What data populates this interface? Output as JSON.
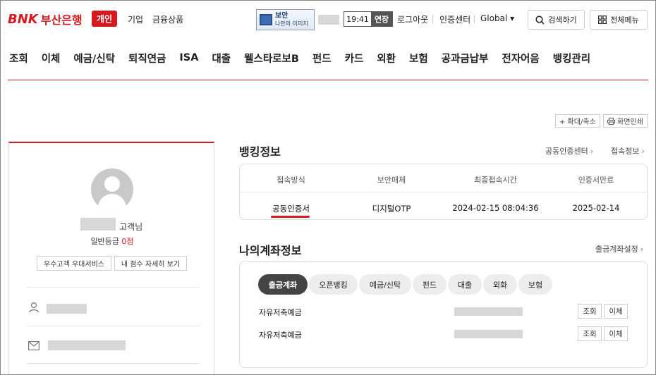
{
  "header": {
    "logo_brand": "BNK",
    "logo_bank": "부산은행",
    "personal_label": "개인",
    "corporate_label": "기업",
    "products_label": "금융상품",
    "security_title": "보안",
    "security_sub": "나만의 이미지",
    "timer_time": "19:41",
    "timer_extend": "연장",
    "logout_label": "로그아웃",
    "cert_center_label": "인증센터",
    "global_label": "Global ▾",
    "search_label": "검색하기",
    "menu_label": "전체메뉴"
  },
  "nav": {
    "items": [
      "조회",
      "이체",
      "예금/신탁",
      "퇴직연금",
      "ISA",
      "대출",
      "웰스타로보B",
      "펀드",
      "카드",
      "외환",
      "보험",
      "공과금납부",
      "전자어음",
      "뱅킹관리"
    ]
  },
  "util": {
    "zoom_label": "+ 확대/축소",
    "print_label": "화면인쇄"
  },
  "profile": {
    "customer_suffix": "고객님",
    "grade_label": "일반등급",
    "grade_points": "0점",
    "vip_button": "우수고객 우대서비스",
    "score_button": "내 점수 자세히 보기"
  },
  "banking": {
    "title": "뱅킹정보",
    "link_cert": "공동인증센터",
    "link_access": "접속정보",
    "headers": [
      "접속방식",
      "보안매체",
      "최종접속시간",
      "인증서만료"
    ],
    "values": [
      "공동인증서",
      "디지털OTP",
      "2024-02-15 08:04:36",
      "2025-02-14"
    ]
  },
  "accounts": {
    "title": "나의계좌정보",
    "setting_link": "출금계좌설정",
    "tabs": [
      "출금계좌",
      "오픈뱅킹",
      "예금/신탁",
      "펀드",
      "대출",
      "외화",
      "보험"
    ],
    "active_tab": 0,
    "rows": [
      {
        "name": "자유저축예금",
        "view": "조회",
        "transfer": "이체"
      },
      {
        "name": "자유저축예금",
        "view": "조회",
        "transfer": "이체"
      }
    ]
  },
  "colors": {
    "brand_red": "#d71920",
    "active_tab": "#444444"
  }
}
